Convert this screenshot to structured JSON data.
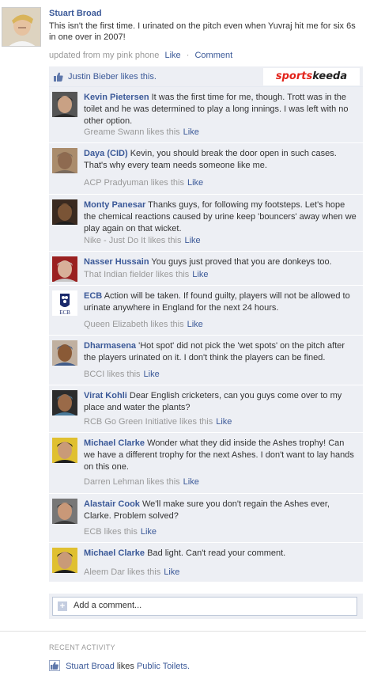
{
  "post": {
    "author": "Stuart Broad",
    "status": "This isn't the first time. I urinated on the pitch even when Yuvraj hit me for six 6s in one over in 2007!",
    "source": "updated from my pink phone",
    "like_label": "Like",
    "separator": "·",
    "comment_label": "Comment"
  },
  "likes_bar": {
    "text": "Justin Bieber likes this.",
    "logo_red": "sports",
    "logo_black": "keeda"
  },
  "comments": [
    {
      "name": "Kevin Pietersen",
      "text": "It was the first time for me, though. Trott was in the toilet and he was determined to play a long innings. I was left with no other option.",
      "likes": "Greame Swann likes this",
      "like_label": "Like"
    },
    {
      "name": "Daya (CID)",
      "text": "Kevin, you should break the door open in such cases. That's why every team needs someone like me.",
      "likes": "ACP Pradyuman likes this",
      "like_label": "Like"
    },
    {
      "name": "Monty Panesar",
      "text": "Thanks guys, for following my footsteps. Let's hope the chemical reactions caused by urine keep 'bouncers' away when we play again on that wicket.",
      "likes": "Nike - Just Do It likes this",
      "like_label": "Like"
    },
    {
      "name": "Nasser Hussain",
      "text": "You guys just proved that you are donkeys too.",
      "likes": "That Indian fielder likes this",
      "like_label": "Like"
    },
    {
      "name": "ECB",
      "text": "Action will be taken. If found guilty, players will not be allowed to urinate anywhere in England for the next 24 hours.",
      "likes": "Queen Elizabeth likes this",
      "like_label": "Like"
    },
    {
      "name": "Dharmasena",
      "text": "'Hot spot' did not pick the 'wet spots' on the pitch after the players urinated on it. I don't think the players can be fined.",
      "likes": "BCCI likes this",
      "like_label": "Like"
    },
    {
      "name": "Virat Kohli",
      "text": "Dear English cricketers, can you guys come over to my place and water the plants?",
      "likes": "RCB Go Green Initiative likes this",
      "like_label": "Like"
    },
    {
      "name": "Michael Clarke",
      "text": "Wonder what they did inside the Ashes trophy! Can we have a different trophy for the next Ashes. I don't want to lay hands on this one.",
      "likes": "Darren Lehman likes this",
      "like_label": "Like"
    },
    {
      "name": "Alastair Cook",
      "text": "We'll make sure you don't regain the Ashes ever, Clarke. Problem solved?",
      "likes": "ECB likes this",
      "like_label": "Like"
    },
    {
      "name": "Michael Clarke",
      "text": "Bad light. Can't read your comment.",
      "likes": "Aleem Dar likes this",
      "like_label": "Like"
    }
  ],
  "add_comment": {
    "placeholder": "Add a comment..."
  },
  "recent": {
    "heading": "RECENT ACTIVITY",
    "actor": "Stuart Broad",
    "verb": "likes",
    "object": "Public Toilets."
  }
}
